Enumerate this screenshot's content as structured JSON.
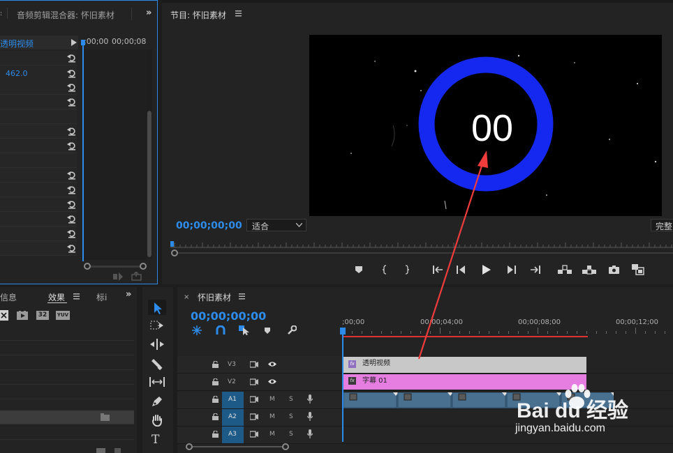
{
  "effect_controls": {
    "tab_title": "音频剪辑混合器: 怀旧素材",
    "clip_name": "透明视频",
    "value": "462.0",
    "time_start": ";00;00",
    "time_end": "00;00;08"
  },
  "program_monitor": {
    "title": "节目: 怀旧素材",
    "timecode": "00;00;00;00",
    "fit_label": "适合",
    "quality_label": "完整",
    "counter_text": "00"
  },
  "effects_panel": {
    "tab_info": "信息",
    "tab_effects": "效果",
    "tab_markers": "标i",
    "badge_32": "32",
    "badge_yuv": "YUV"
  },
  "timeline": {
    "sequence_name": "怀旧素材",
    "timecode": "00;00;00;00",
    "ruler_labels": [
      ";00;00",
      "00;00;04;00",
      "00;00;08;00",
      "00;00;12;00"
    ],
    "tracks": [
      {
        "name": "V3",
        "type": "video"
      },
      {
        "name": "V2",
        "type": "video"
      },
      {
        "name": "A1",
        "type": "audio",
        "m": "M",
        "s": "S"
      },
      {
        "name": "A2",
        "type": "audio",
        "m": "M",
        "s": "S"
      },
      {
        "name": "A3",
        "type": "audio",
        "m": "M",
        "s": "S"
      }
    ],
    "clips": {
      "v3": "透明视频",
      "v2": "字幕 01"
    }
  },
  "watermark": {
    "brand": "Bai du 经验",
    "url": "jingyan.baidu.com"
  },
  "colors": {
    "accent_blue": "#2d8ceb",
    "ring_blue": "#1428f0",
    "arrow_red": "#f03c3c",
    "clip_v3": "#c8c8c8",
    "clip_v2": "#e57ee0",
    "clip_audio": "#3f6583",
    "track_active": "#1e5a88"
  }
}
